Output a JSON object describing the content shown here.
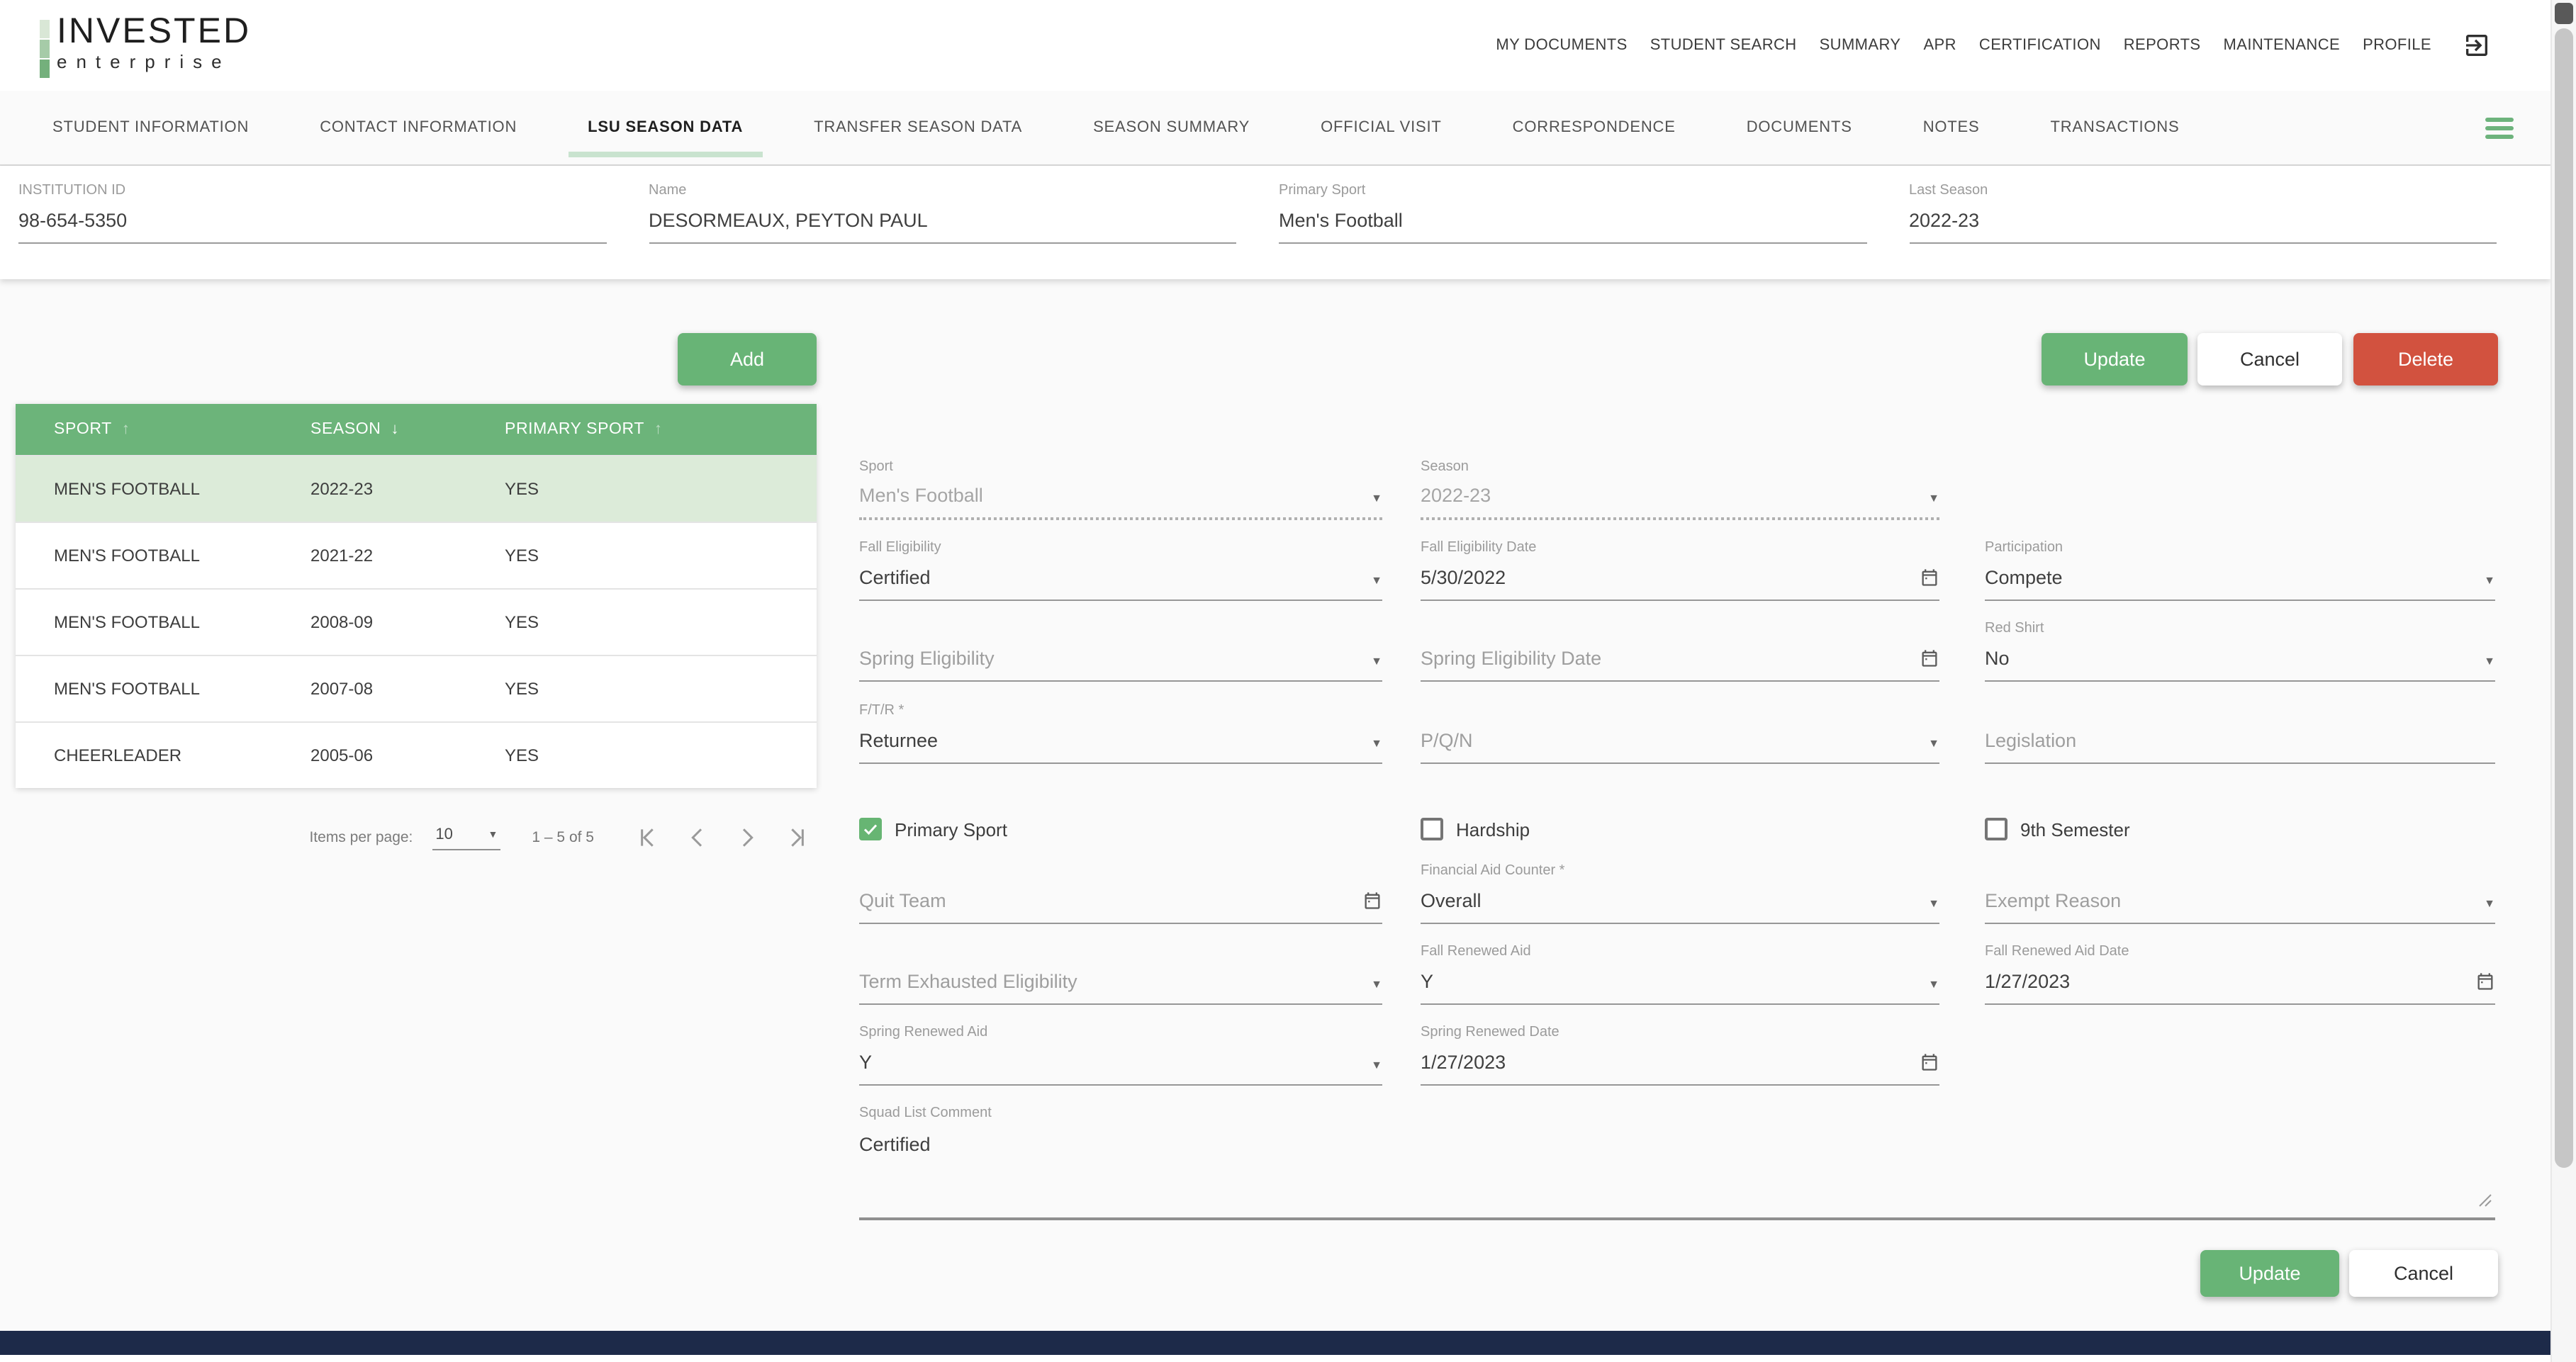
{
  "brand": {
    "title": "INVESTED",
    "subtitle": "enterprise"
  },
  "nav": {
    "items": [
      "MY DOCUMENTS",
      "STUDENT SEARCH",
      "SUMMARY",
      "APR",
      "CERTIFICATION",
      "REPORTS",
      "MAINTENANCE",
      "PROFILE"
    ]
  },
  "tabs": {
    "items": [
      "STUDENT INFORMATION",
      "CONTACT INFORMATION",
      "LSU SEASON DATA",
      "TRANSFER SEASON DATA",
      "SEASON SUMMARY",
      "OFFICIAL VISIT",
      "CORRESPONDENCE",
      "DOCUMENTS",
      "NOTES",
      "TRANSACTIONS"
    ],
    "active": "LSU SEASON DATA"
  },
  "student": {
    "institution_id": {
      "label": "INSTITUTION ID",
      "value": "98-654-5350"
    },
    "name": {
      "label": "Name",
      "value": "DESORMEAUX, PEYTON PAUL"
    },
    "primary_sport": {
      "label": "Primary Sport",
      "value": "Men's Football"
    },
    "last_season": {
      "label": "Last Season",
      "value": "2022-23"
    }
  },
  "toolbar": {
    "add": "Add",
    "update": "Update",
    "cancel": "Cancel",
    "delete": "Delete"
  },
  "table": {
    "columns": [
      {
        "label": "SPORT",
        "sort": "asc"
      },
      {
        "label": "SEASON",
        "sort": "desc"
      },
      {
        "label": "PRIMARY SPORT",
        "sort": "asc"
      }
    ],
    "rows": [
      {
        "sport": "MEN'S FOOTBALL",
        "season": "2022-23",
        "primary": "YES",
        "selected": true
      },
      {
        "sport": "MEN'S FOOTBALL",
        "season": "2021-22",
        "primary": "YES",
        "selected": false
      },
      {
        "sport": "MEN'S FOOTBALL",
        "season": "2008-09",
        "primary": "YES",
        "selected": false
      },
      {
        "sport": "MEN'S FOOTBALL",
        "season": "2007-08",
        "primary": "YES",
        "selected": false
      },
      {
        "sport": "CHEERLEADER",
        "season": "2005-06",
        "primary": "YES",
        "selected": false
      }
    ]
  },
  "paginator": {
    "items_per_page": "Items per page:",
    "page_size": "10",
    "range": "1 – 5 of 5"
  },
  "form": {
    "sport": {
      "label": "Sport",
      "value": "Men's Football",
      "disabled": true
    },
    "season": {
      "label": "Season",
      "value": "2022-23",
      "disabled": true
    },
    "fall_eligibility": {
      "label": "Fall Eligibility",
      "value": "Certified"
    },
    "fall_eligibility_date": {
      "label": "Fall Eligibility Date",
      "value": "5/30/2022"
    },
    "participation": {
      "label": "Participation",
      "value": "Compete"
    },
    "spring_eligibility": {
      "placeholder": "Spring Eligibility"
    },
    "spring_eligibility_date": {
      "placeholder": "Spring Eligibility Date"
    },
    "red_shirt": {
      "label": "Red Shirt",
      "value": "No"
    },
    "ftr": {
      "label": "F/T/R *",
      "value": "Returnee"
    },
    "pqn": {
      "placeholder": "P/Q/N"
    },
    "legislation": {
      "placeholder": "Legislation"
    },
    "primary_sport_check": {
      "label": "Primary Sport",
      "checked": true
    },
    "hardship_check": {
      "label": "Hardship",
      "checked": false
    },
    "ninth_semester_check": {
      "label": "9th Semester",
      "checked": false
    },
    "quit_team": {
      "placeholder": "Quit Team"
    },
    "financial_aid_counter": {
      "label": "Financial Aid Counter *",
      "value": "Overall"
    },
    "exempt_reason": {
      "placeholder": "Exempt Reason"
    },
    "term_exhausted": {
      "placeholder": "Term Exhausted Eligibility"
    },
    "fall_renewed_aid": {
      "label": "Fall Renewed Aid",
      "value": "Y"
    },
    "fall_renewed_aid_date": {
      "label": "Fall Renewed Aid Date",
      "value": "1/27/2023"
    },
    "spring_renewed_aid": {
      "label": "Spring Renewed Aid",
      "value": "Y"
    },
    "spring_renewed_date": {
      "label": "Spring Renewed Date",
      "value": "1/27/2023"
    },
    "squad_list_comment": {
      "label": "Squad List Comment",
      "value": "Certified"
    },
    "buttons": {
      "update": "Update",
      "cancel": "Cancel"
    }
  },
  "icons": {
    "dropdown": "▼",
    "sort_asc": "↑",
    "sort_desc": "↓"
  },
  "colors": {
    "accent_green": "#6cb47a",
    "selected_row": "#dcebd9",
    "delete_red": "#d2523f",
    "footer_navy": "#1d2a49"
  }
}
